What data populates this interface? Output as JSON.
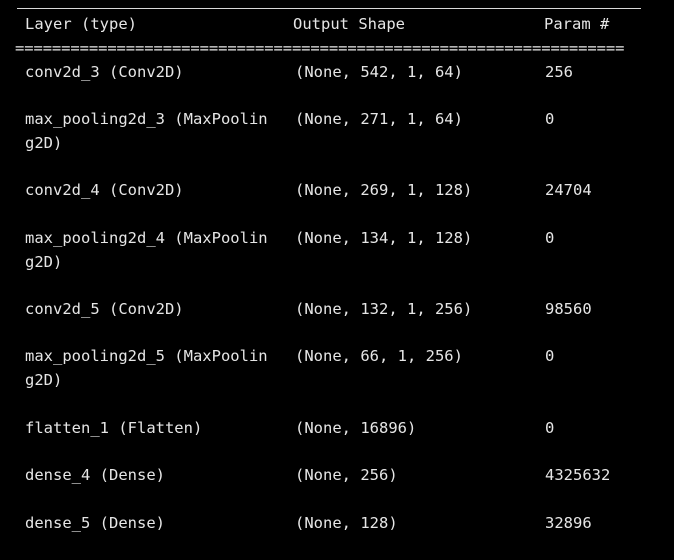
{
  "table": {
    "headers": {
      "layer": "Layer (type)",
      "shape": "Output Shape",
      "param": "Param #"
    },
    "separator": "==================================================================",
    "rows": [
      {
        "layer": "conv2d_3 (Conv2D)",
        "shape": "(None, 542, 1, 64)",
        "param": "256"
      },
      {
        "layer": "max_pooling2d_3 (MaxPoolin",
        "layer_cont": "g2D)",
        "shape": "(None, 271, 1, 64)",
        "param": "0"
      },
      {
        "layer": "conv2d_4 (Conv2D)",
        "shape": "(None, 269, 1, 128)",
        "param": "24704"
      },
      {
        "layer": "max_pooling2d_4 (MaxPoolin",
        "layer_cont": "g2D)",
        "shape": "(None, 134, 1, 128)",
        "param": "0"
      },
      {
        "layer": "conv2d_5 (Conv2D)",
        "shape": "(None, 132, 1, 256)",
        "param": "98560"
      },
      {
        "layer": "max_pooling2d_5 (MaxPoolin",
        "layer_cont": "g2D)",
        "shape": "(None, 66, 1, 256)",
        "param": "0"
      },
      {
        "layer": "flatten_1 (Flatten)",
        "shape": "(None, 16896)",
        "param": "0"
      },
      {
        "layer": "dense_4 (Dense)",
        "shape": "(None, 256)",
        "param": "4325632"
      },
      {
        "layer": "dense_5 (Dense)",
        "shape": "(None, 128)",
        "param": "32896"
      }
    ]
  },
  "colors": {
    "background": "#000000",
    "text": "#e6e6e6",
    "rule": "#d8d8d8"
  }
}
